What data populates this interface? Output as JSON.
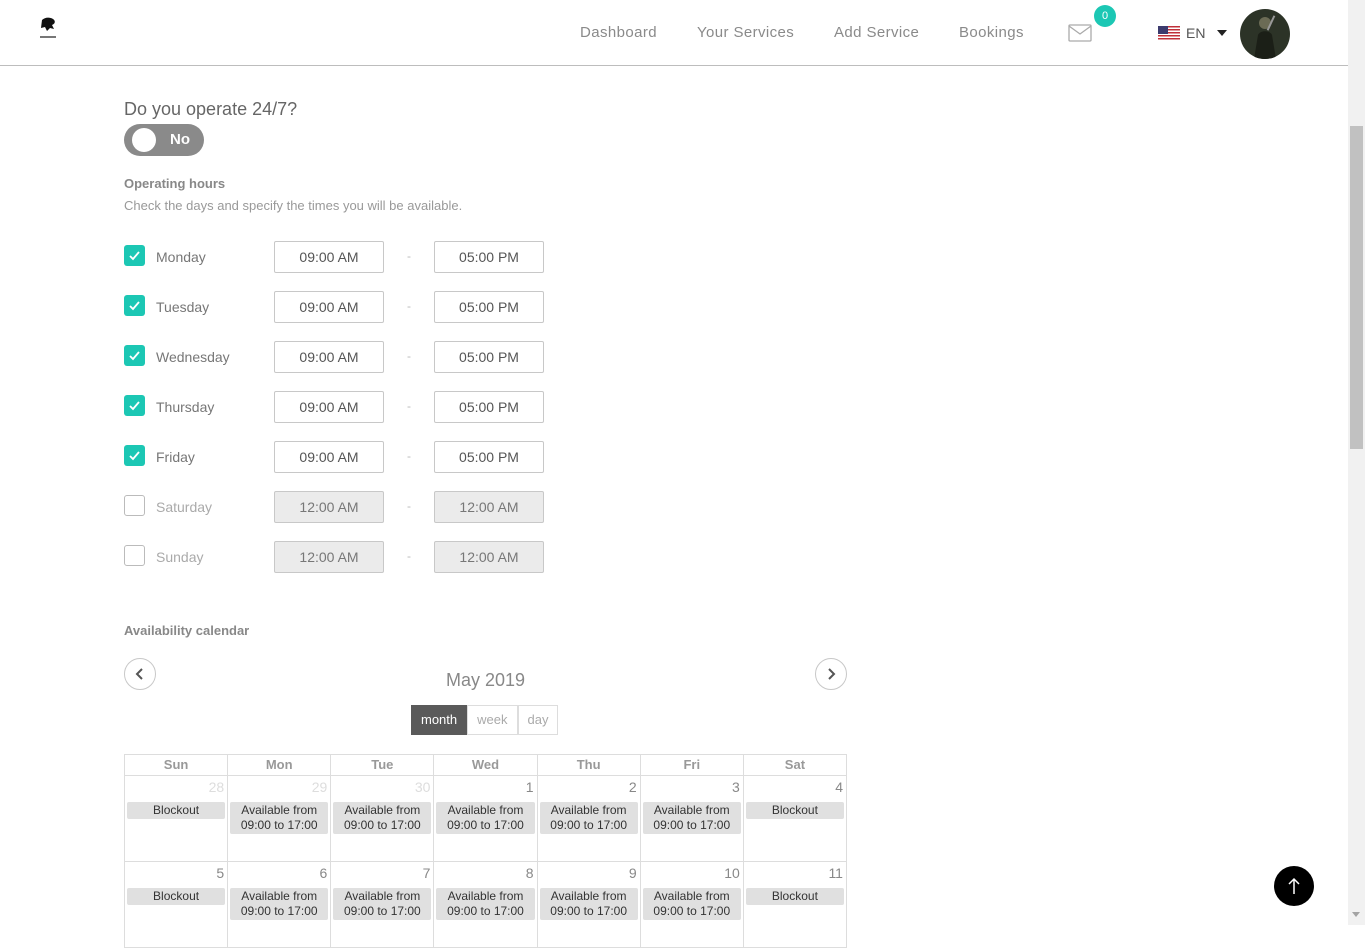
{
  "header": {
    "nav": [
      {
        "label": "Dashboard"
      },
      {
        "label": "Your Services"
      },
      {
        "label": "Add Service"
      },
      {
        "label": "Bookings"
      }
    ],
    "mail_count": "0",
    "language": "EN",
    "icons": {
      "mail": "mail-icon",
      "flag": "us-flag-icon",
      "caret": "caret-down-icon",
      "logo": "logo"
    }
  },
  "operate": {
    "question": "Do you operate 24/7?",
    "toggle_label": "No",
    "toggle_on": false
  },
  "hours": {
    "title": "Operating hours",
    "subtitle": "Check the days and specify the times you will be available.",
    "separator": "-",
    "days": [
      {
        "name": "Monday",
        "checked": true,
        "from": "09:00 AM",
        "to": "05:00 PM"
      },
      {
        "name": "Tuesday",
        "checked": true,
        "from": "09:00 AM",
        "to": "05:00 PM"
      },
      {
        "name": "Wednesday",
        "checked": true,
        "from": "09:00 AM",
        "to": "05:00 PM"
      },
      {
        "name": "Thursday",
        "checked": true,
        "from": "09:00 AM",
        "to": "05:00 PM"
      },
      {
        "name": "Friday",
        "checked": true,
        "from": "09:00 AM",
        "to": "05:00 PM"
      },
      {
        "name": "Saturday",
        "checked": false,
        "from": "12:00 AM",
        "to": "12:00 AM"
      },
      {
        "name": "Sunday",
        "checked": false,
        "from": "12:00 AM",
        "to": "12:00 AM"
      }
    ]
  },
  "calendar": {
    "title": "Availability calendar",
    "month": "May 2019",
    "views": [
      "month",
      "week",
      "day"
    ],
    "active_view": "month",
    "weekdays": [
      "Sun",
      "Mon",
      "Tue",
      "Wed",
      "Thu",
      "Fri",
      "Sat"
    ],
    "weeks": [
      [
        {
          "day": "28",
          "other": true,
          "event": "Blockout"
        },
        {
          "day": "29",
          "other": true,
          "event": "Available from 09:00 to 17:00"
        },
        {
          "day": "30",
          "other": true,
          "event": "Available from 09:00 to 17:00"
        },
        {
          "day": "1",
          "other": false,
          "event": "Available from 09:00 to 17:00"
        },
        {
          "day": "2",
          "other": false,
          "event": "Available from 09:00 to 17:00"
        },
        {
          "day": "3",
          "other": false,
          "event": "Available from 09:00 to 17:00"
        },
        {
          "day": "4",
          "other": false,
          "event": "Blockout"
        }
      ],
      [
        {
          "day": "5",
          "other": false,
          "event": "Blockout"
        },
        {
          "day": "6",
          "other": false,
          "event": "Available from 09:00 to 17:00"
        },
        {
          "day": "7",
          "other": false,
          "event": "Available from 09:00 to 17:00"
        },
        {
          "day": "8",
          "other": false,
          "event": "Available from 09:00 to 17:00"
        },
        {
          "day": "9",
          "other": false,
          "event": "Available from 09:00 to 17:00"
        },
        {
          "day": "10",
          "other": false,
          "event": "Available from 09:00 to 17:00"
        },
        {
          "day": "11",
          "other": false,
          "event": "Blockout"
        }
      ]
    ]
  },
  "colors": {
    "accent": "#1cc7b4",
    "toggle_off": "#8a8a8a",
    "event_bg": "#e0e0e0"
  }
}
